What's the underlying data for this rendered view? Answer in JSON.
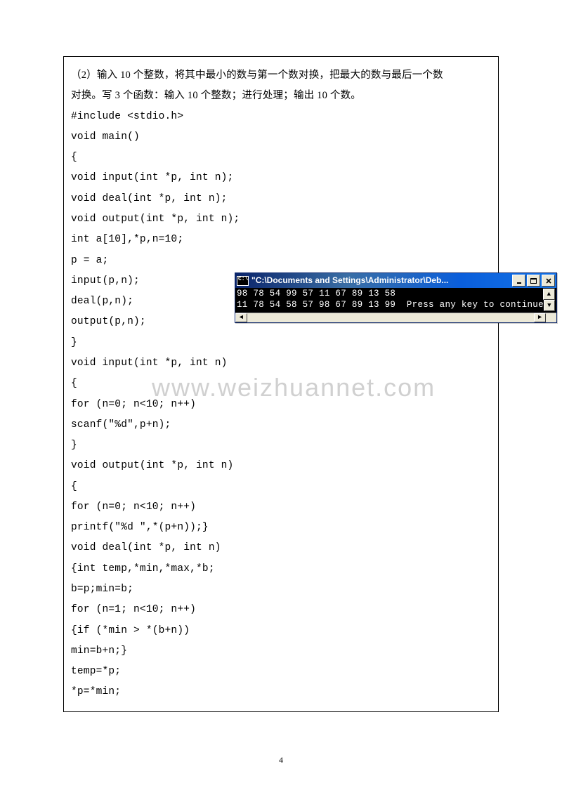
{
  "problem": {
    "line1": "（2）输入 10 个整数，将其中最小的数与第一个数对换，把最大的数与最后一个数",
    "line2": "对换。写 3 个函数：输入 10 个整数；进行处理；输出 10 个数。"
  },
  "code": [
    "#include <stdio.h>",
    "void main()",
    "{",
    "void input(int *p, int n);",
    "void deal(int *p, int n);",
    "void output(int *p, int n);",
    "int a[10],*p,n=10;",
    "p = a;",
    "input(p,n);",
    "deal(p,n);",
    "output(p,n);",
    "}",
    "void input(int *p, int n)",
    "{",
    "for (n=0; n<10; n++)",
    "scanf(\"%d\",p+n);",
    "}",
    "void output(int *p, int n)",
    "{",
    "for (n=0; n<10; n++)",
    "printf(\"%d \",*(p+n));}",
    "void deal(int *p, int n)",
    "{int temp,*min,*max,*b;",
    "b=p;min=b;",
    "for (n=1; n<10; n++)",
    "{if (*min > *(b+n))",
    "min=b+n;}",
    "temp=*p;",
    "*p=*min;"
  ],
  "watermark": "www.weizhuannet.com",
  "console": {
    "icon_text": "C:\\",
    "title": "\"C:\\Documents and Settings\\Administrator\\Deb...",
    "line1": "98 78 54 99 57 11 67 89 13 58",
    "line2": "11 78 54 58 57 98 67 89 13 99  Press any key to continue"
  },
  "page_number": "4"
}
